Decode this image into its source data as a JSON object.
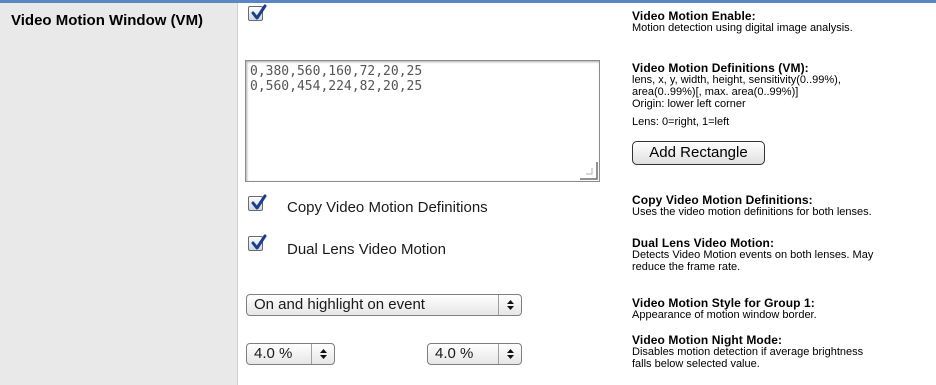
{
  "section": {
    "title": "Video Motion Window (VM)"
  },
  "enable": {
    "checked": true,
    "title": "Video Motion Enable:",
    "desc": "Motion detection using digital image analysis."
  },
  "definitions": {
    "lines": "0,380,560,160,72,20,25\n0,560,454,224,82,20,25",
    "title": "Video Motion Definitions (VM):",
    "desc1": "lens, x, y, width, height, sensitivity(0..99%),",
    "desc2": "area(0..99%)[, max. area(0..99%)]",
    "desc3": "Origin: lower left corner",
    "desc4": "Lens: 0=right, 1=left",
    "add_button": "Add Rectangle"
  },
  "copy": {
    "checked": true,
    "label": "Copy Video Motion Definitions",
    "title": "Copy Video Motion Definitions:",
    "desc": "Uses the video motion definitions for both lenses."
  },
  "dual": {
    "checked": true,
    "label": "Dual Lens Video Motion",
    "title": "Dual Lens Video Motion:",
    "desc1": "Detects Video Motion events on both lenses. May",
    "desc2": "reduce the frame rate."
  },
  "style": {
    "value": "On and highlight on event",
    "title": "Video Motion Style for Group 1:",
    "desc": "Appearance of motion window border."
  },
  "night": {
    "value_left": "4.0 %",
    "value_right": "4.0 %",
    "title": "Video Motion Night Mode:",
    "desc1": "Disables motion detection if average brightness",
    "desc2": "falls below selected value."
  }
}
